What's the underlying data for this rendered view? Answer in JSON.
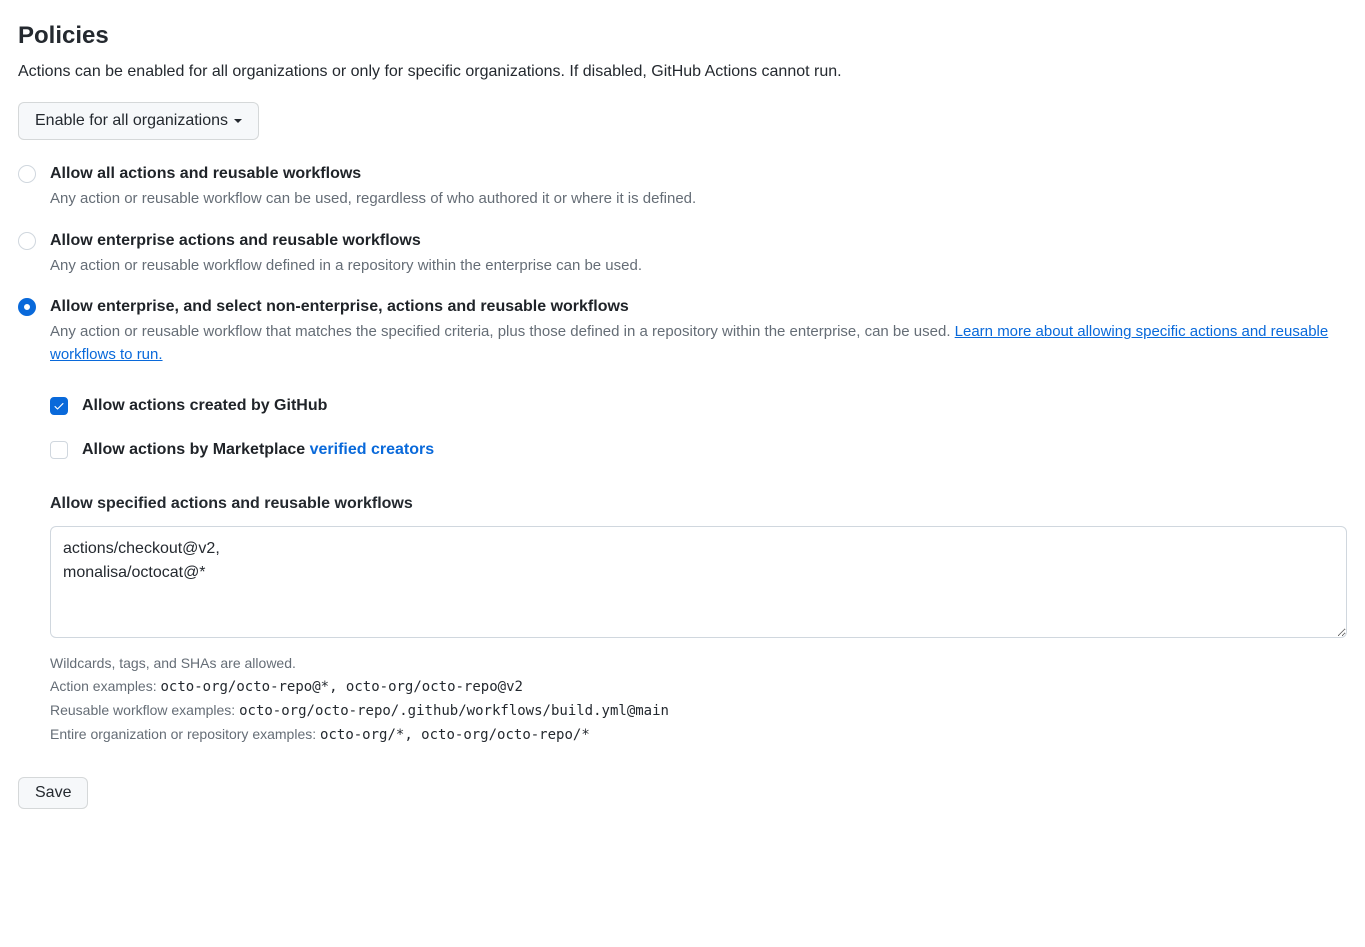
{
  "header": {
    "title": "Policies",
    "subtitle": "Actions can be enabled for all organizations or only for specific organizations. If disabled, GitHub Actions cannot run."
  },
  "enablement_dropdown": {
    "selected_label": "Enable for all organizations"
  },
  "policy_options": [
    {
      "title": "Allow all actions and reusable workflows",
      "description": "Any action or reusable workflow can be used, regardless of who authored it or where it is defined.",
      "selected": false
    },
    {
      "title": "Allow enterprise actions and reusable workflows",
      "description": "Any action or reusable workflow defined in a repository within the enterprise can be used.",
      "selected": false
    },
    {
      "title": "Allow enterprise, and select non-enterprise, actions and reusable workflows",
      "description_prefix": "Any action or reusable workflow that matches the specified criteria, plus those defined in a repository within the enterprise, can be used. ",
      "learn_more": "Learn more about allowing specific actions and reusable workflows to run.",
      "selected": true
    }
  ],
  "sub_options": {
    "allow_github": {
      "label": "Allow actions created by GitHub",
      "checked": true
    },
    "allow_marketplace": {
      "label_prefix": "Allow actions by Marketplace ",
      "link_text": "verified creators",
      "checked": false
    }
  },
  "specified": {
    "heading": "Allow specified actions and reusable workflows",
    "textarea_value": "actions/checkout@v2,\nmonalisa/octocat@*"
  },
  "hints": {
    "line1": "Wildcards, tags, and SHAs are allowed.",
    "action_label": "Action examples: ",
    "action_examples": "octo-org/octo-repo@*, octo-org/octo-repo@v2",
    "reusable_label": "Reusable workflow examples: ",
    "reusable_examples": "octo-org/octo-repo/.github/workflows/build.yml@main",
    "org_label": "Entire organization or repository examples: ",
    "org_examples": "octo-org/*, octo-org/octo-repo/*"
  },
  "save_button": "Save"
}
